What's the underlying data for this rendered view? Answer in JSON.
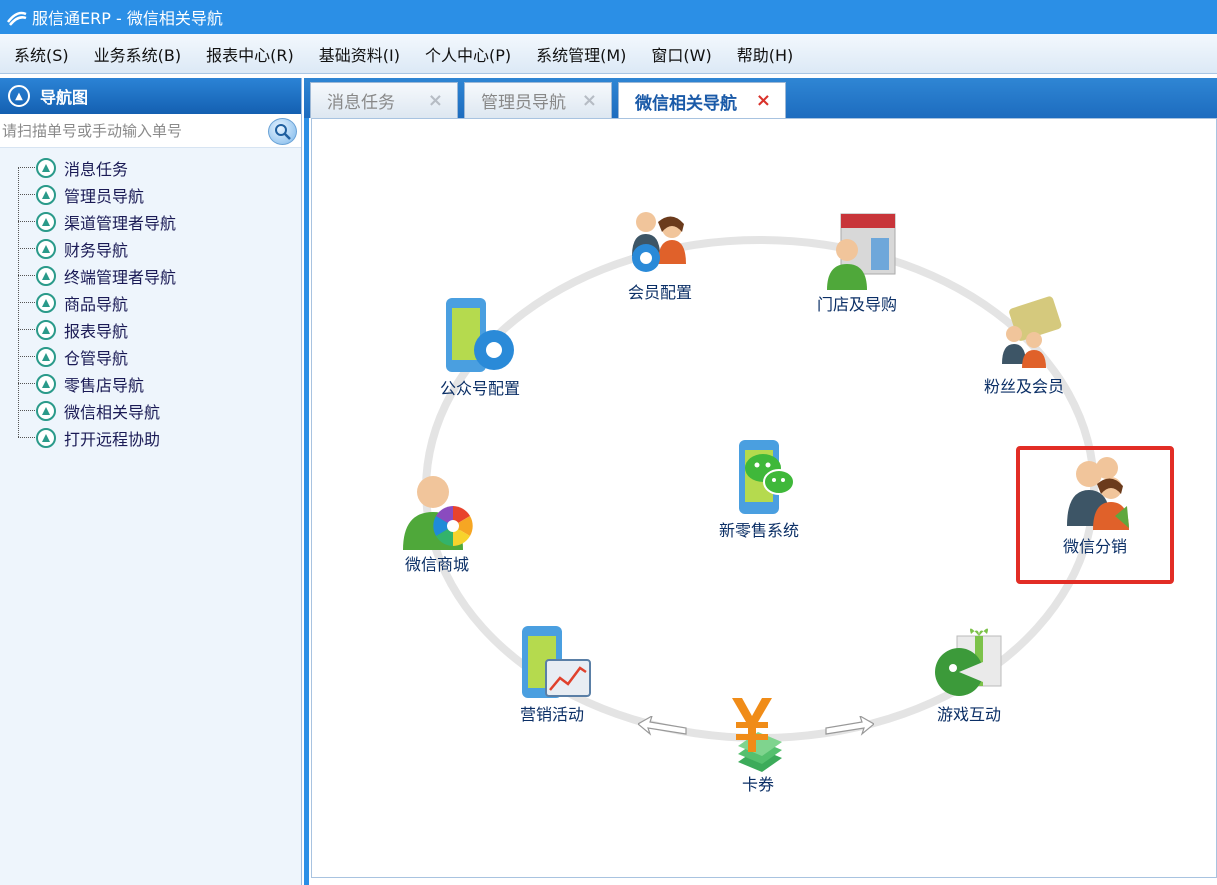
{
  "window": {
    "title": "服信通ERP - 微信相关导航"
  },
  "menu": {
    "items": [
      "系统(S)",
      "业务系统(B)",
      "报表中心(R)",
      "基础资料(I)",
      "个人中心(P)",
      "系统管理(M)",
      "窗口(W)",
      "帮助(H)"
    ]
  },
  "nav": {
    "header": "导航图",
    "search_placeholder": "请扫描单号或手动输入单号",
    "items": [
      "消息任务",
      "管理员导航",
      "渠道管理者导航",
      "财务导航",
      "终端管理者导航",
      "商品导航",
      "报表导航",
      "仓管导航",
      "零售店导航",
      "微信相关导航",
      "打开远程协助"
    ]
  },
  "tabs": [
    {
      "label": "消息任务",
      "close": "×"
    },
    {
      "label": "管理员导航",
      "close": "×"
    },
    {
      "label": "微信相关导航",
      "close": "×",
      "active": true
    }
  ],
  "diagram": {
    "center": "新零售系统",
    "nodes": {
      "member_config": "会员配置",
      "store_guide": "门店及导购",
      "fans_members": "粉丝及会员",
      "wechat_distribution": "微信分销",
      "game_interaction": "游戏互动",
      "coupon": "卡券",
      "marketing": "营销活动",
      "wechat_mall": "微信商城",
      "official_account": "公众号配置"
    },
    "highlighted": "wechat_distribution"
  },
  "colors": {
    "title_bar": "#2b8fe6",
    "highlight_border": "#e22d25",
    "node_text": "#0b2f66"
  }
}
